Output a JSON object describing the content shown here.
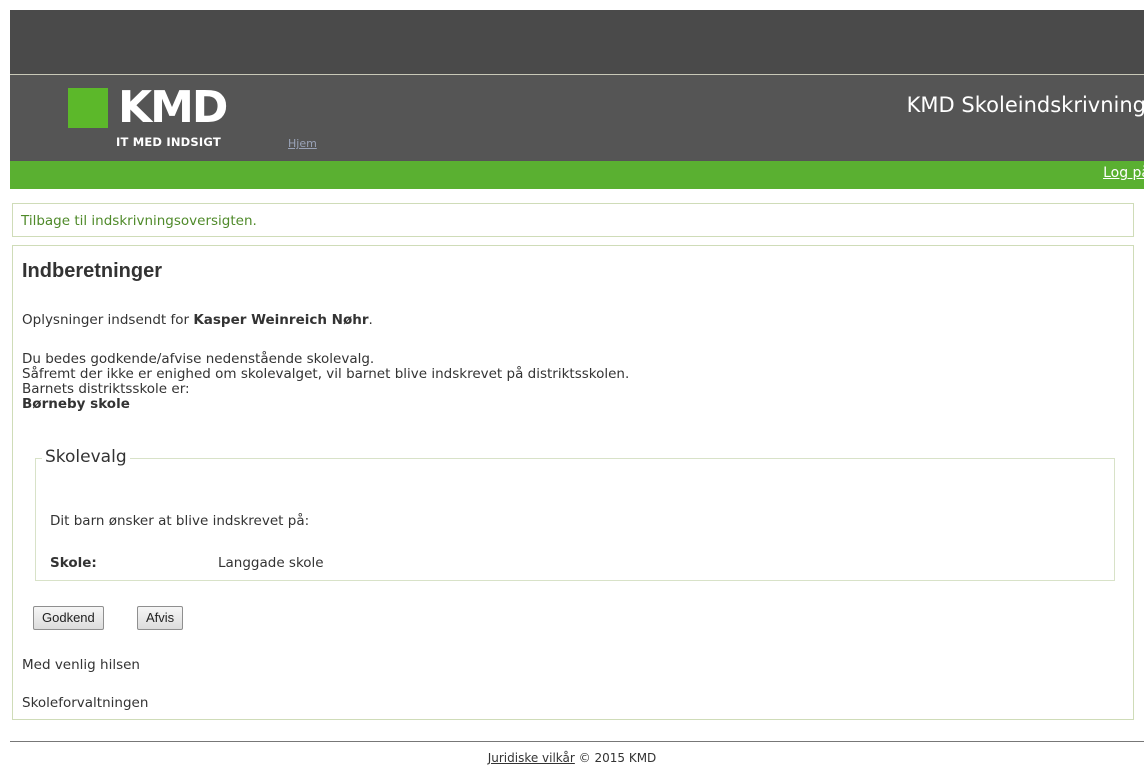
{
  "header": {
    "logo_word": "KMD",
    "logo_tagline": "IT MED INDSIGT",
    "home_link": "Hjem",
    "app_title": "KMD Skoleindskrivning",
    "login_link": "Log på"
  },
  "back_link": "Tilbage til indskrivningsoversigten.",
  "main": {
    "title": "Indberetninger",
    "intro_prefix": "Oplysninger indsendt for ",
    "child_name": "Kasper Weinreich Nøhr",
    "intro_suffix": ".",
    "line1": "Du bedes godkende/afvise nedenstående skolevalg.",
    "line2": "Såfremt der ikke er enighed om skolevalget, vil barnet blive indskrevet på distriktsskolen.",
    "line3": "Barnets distriktsskole er:",
    "district_school": "Børneby skole"
  },
  "school_choice": {
    "legend": "Skolevalg",
    "wish_text": "Dit barn ønsker at blive indskrevet på:",
    "school_label": "Skole:",
    "school_value": "Langgade skole"
  },
  "buttons": {
    "approve": "Godkend",
    "reject": "Afvis"
  },
  "closing": {
    "greeting": "Med venlig hilsen",
    "sender": "Skoleforvaltningen"
  },
  "footer": {
    "terms_link": "Juridiske vilkår",
    "copyright": " © 2015 KMD"
  },
  "colors": {
    "brand_green": "#5ab031",
    "header_dark": "#555555"
  }
}
